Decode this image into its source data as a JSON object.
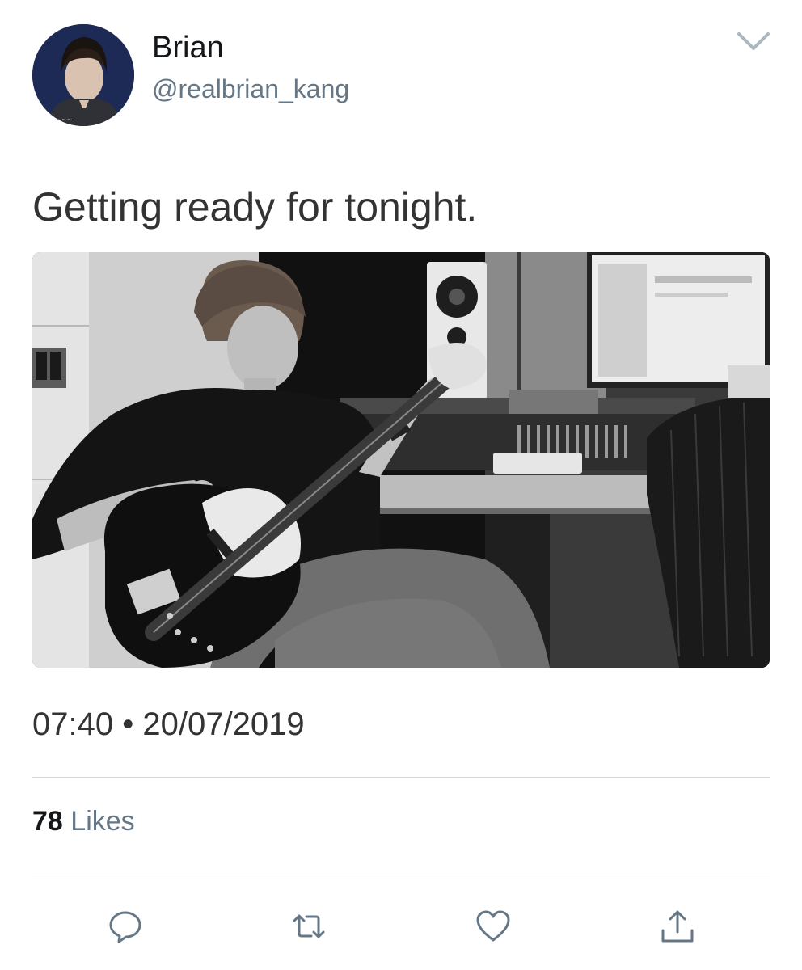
{
  "user": {
    "name": "Brian",
    "handle": "@realbrian_kang",
    "avatar_icon": "profile-photo"
  },
  "tweet": {
    "text": "Getting ready for tonight.",
    "media_description_icon": "studio-bass-guitar-photo",
    "time": "07:40",
    "separator": "•",
    "date": "20/07/2019"
  },
  "stats": {
    "likes_count": "78",
    "likes_label": "Likes"
  },
  "actions": {
    "icons": [
      "reply-icon",
      "retweet-icon",
      "like-icon",
      "share-icon"
    ]
  },
  "colors": {
    "text_primary": "#14171a",
    "text_secondary": "#657786",
    "divider": "#d6d6d6",
    "icon": "#657786"
  }
}
